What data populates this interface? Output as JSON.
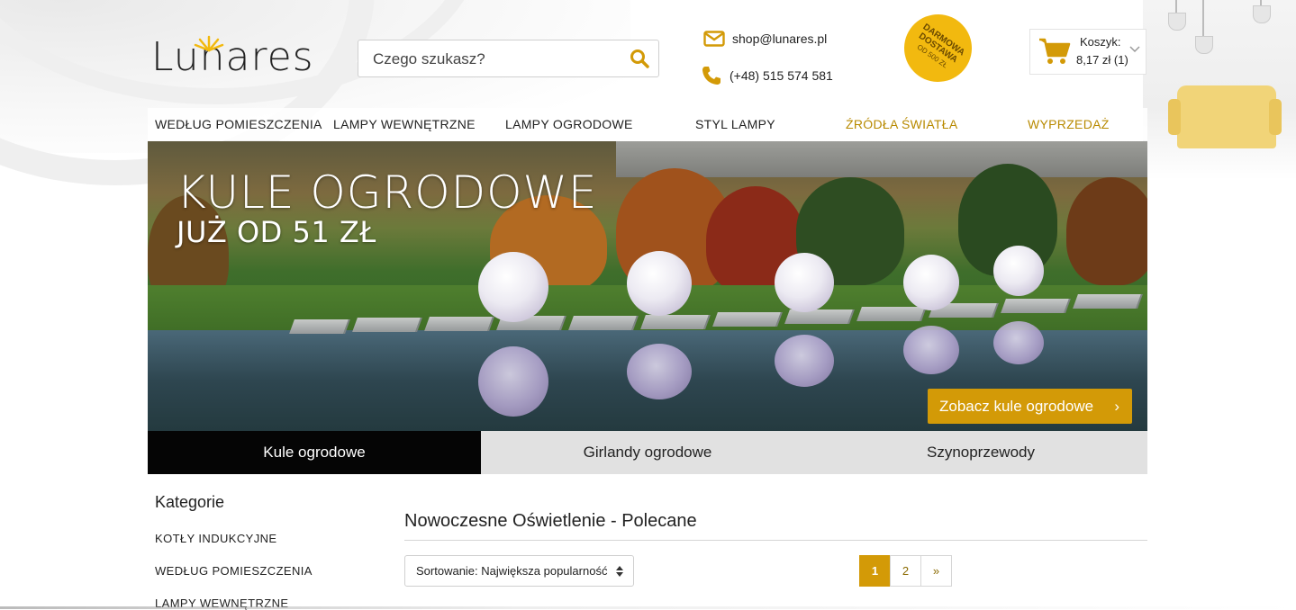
{
  "header": {
    "logo_text": "Lunares",
    "search_placeholder": "Czego szukasz?",
    "email": "shop@lunares.pl",
    "phone": "(+48) 515 574 581",
    "badge": {
      "line1": "DARMOWA",
      "line2": "DOSTAWA",
      "line3": "OD 500 ZŁ"
    },
    "cart": {
      "label": "Koszyk:",
      "value": "8,17 zł (1)"
    }
  },
  "nav": {
    "items": [
      {
        "label": "WEDŁUG POMIESZCZENIA"
      },
      {
        "label": "LAMPY WEWNĘTRZNE"
      },
      {
        "label": "LAMPY OGRODOWE"
      },
      {
        "label": "STYL LAMPY"
      },
      {
        "label": "ŹRÓDŁA ŚWIATŁA"
      },
      {
        "label": "WYPRZEDAŻ"
      }
    ]
  },
  "hero": {
    "title": "KULE OGRODOWE",
    "subtitle": "JUŻ OD 51 ZŁ",
    "cta": "Zobacz kule ogrodowe",
    "cta_arrow": "›",
    "tabs": [
      {
        "label": "Kule ogrodowe"
      },
      {
        "label": "Girlandy ogrodowe"
      },
      {
        "label": "Szynoprzewody"
      }
    ]
  },
  "sidebar": {
    "title": "Kategorie",
    "items": [
      {
        "label": "KOTŁY INDUKCYJNE"
      },
      {
        "label": "WEDŁUG POMIESZCZENIA"
      },
      {
        "label": "LAMPY WEWNĘTRZNE"
      }
    ]
  },
  "main": {
    "title": "Nowoczesne Oświetlenie - Polecane",
    "sort_value": "Sortowanie: Największa popularność",
    "pagination": [
      "1",
      "2",
      "»"
    ]
  },
  "colors": {
    "accent": "#d39a07",
    "nav_highlight": "#b88a00",
    "tab_active": "#050505",
    "tab_inactive": "#e1e1e1"
  },
  "icons": [
    "envelope-icon",
    "phone-icon",
    "search-icon",
    "cart-icon",
    "chevron-down-icon",
    "sort-arrows-icon"
  ]
}
